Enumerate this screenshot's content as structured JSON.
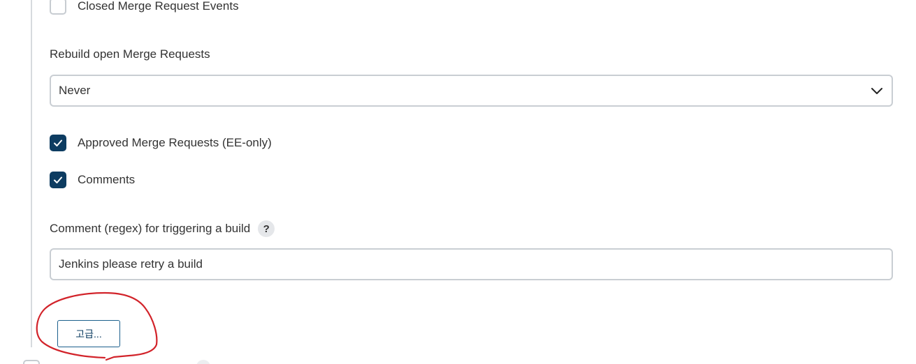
{
  "options": {
    "closed_mr_events": {
      "label": "Closed Merge Request Events",
      "checked": false
    },
    "rebuild_open_mr": {
      "label": "Rebuild open Merge Requests",
      "selected": "Never"
    },
    "approved_mr": {
      "label": "Approved Merge Requests (EE-only)",
      "checked": true
    },
    "comments": {
      "label": "Comments",
      "checked": true
    },
    "comment_regex": {
      "label": "Comment (regex) for triggering a build",
      "help_icon": "?",
      "value": "Jenkins please retry a build"
    }
  },
  "advanced_button": {
    "label": "고급..."
  },
  "colors": {
    "checked_fill": "#0d3c61",
    "annotation": "#d2232a",
    "border": "#c9ced3"
  },
  "icons": {
    "select_chevron": "chevron-down-icon",
    "check": "checkmark-icon",
    "help": "help-icon"
  }
}
